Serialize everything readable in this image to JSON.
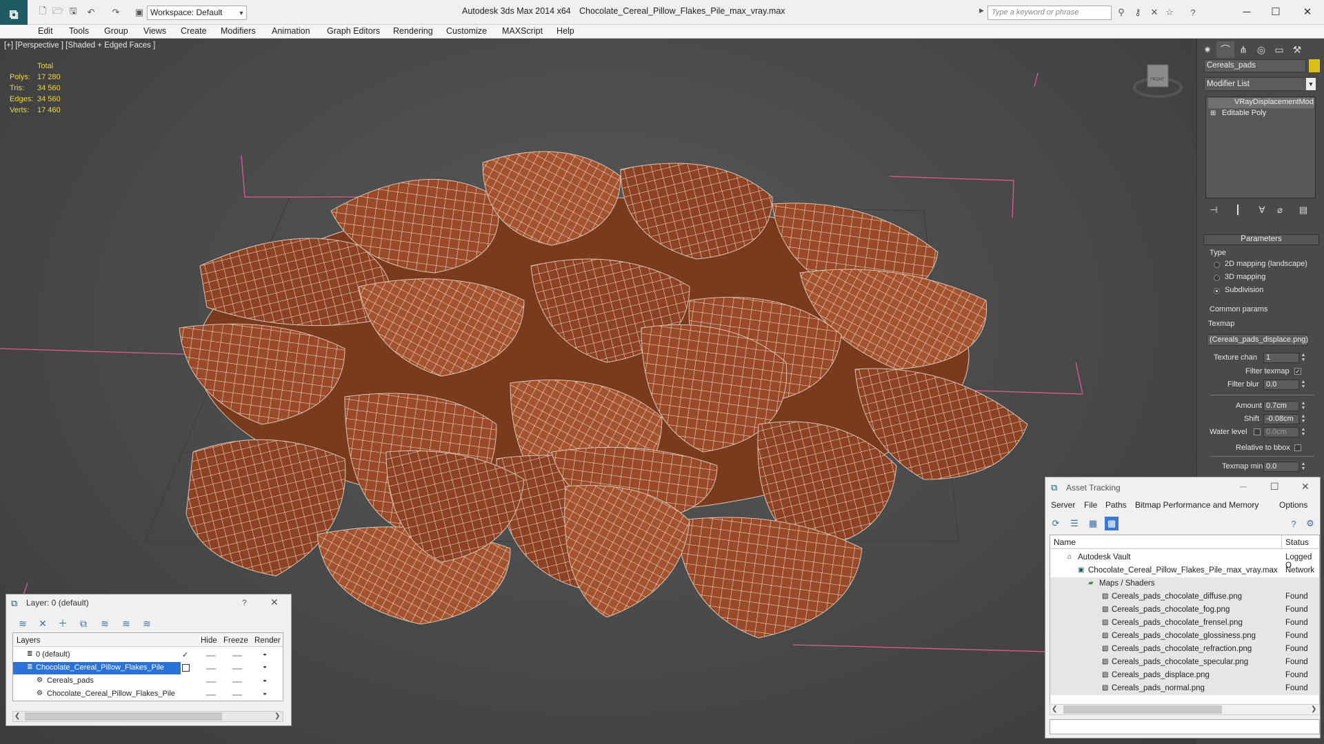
{
  "window": {
    "app_title": "Autodesk 3ds Max  2014 x64",
    "doc_title": "Chocolate_Cereal_Pillow_Flakes_Pile_max_vray.max",
    "workspace": "Workspace: Default",
    "search_placeholder": "Type a keyword or phrase"
  },
  "menu": [
    "Edit",
    "Tools",
    "Group",
    "Views",
    "Create",
    "Modifiers",
    "Animation",
    "Graph Editors",
    "Rendering",
    "Customize",
    "MAXScript",
    "Help"
  ],
  "viewport": {
    "label": "[+] [Perspective ] [Shaded + Edged Faces ]",
    "viewcube_label": "FRONT",
    "stats": {
      "header": "Total",
      "rows": [
        {
          "k": "Polys:",
          "v": "17 280"
        },
        {
          "k": "Tris:",
          "v": "34 560"
        },
        {
          "k": "Edges:",
          "v": "34 560"
        },
        {
          "k": "Verts:",
          "v": "17 460"
        }
      ]
    }
  },
  "command_panel": {
    "object_name": "Cereals_pads",
    "object_color": "#d8c020",
    "modifier_list": "Modifier List",
    "stack": [
      "VRayDisplacementMod",
      "Editable Poly"
    ],
    "parameters": {
      "title": "Parameters",
      "type_label": "Type",
      "type_options": [
        "2D mapping (landscape)",
        "3D mapping",
        "Subdivision"
      ],
      "type_selected": 2,
      "common_label": "Common params",
      "texmap_label": "Texmap",
      "texmap_value": "(Cereals_pads_displace.png)",
      "texture_chan_label": "Texture chan",
      "texture_chan_value": "1",
      "filter_texmap_label": "Filter texmap",
      "filter_blur_label": "Filter blur",
      "filter_blur_value": "0.0",
      "amount_label": "Amount",
      "amount_value": "0.7cm",
      "shift_label": "Shift",
      "shift_value": "-0.08cm",
      "water_label": "Water level",
      "water_value": "0.0cm",
      "relative_label": "Relative to bbox",
      "texmap_min_label": "Texmap min",
      "texmap_min_value": "0.0"
    }
  },
  "layer_dialog": {
    "title": "Layer: 0 (default)",
    "help": "?",
    "columns": [
      "Layers",
      "Hide",
      "Freeze",
      "Render"
    ],
    "rows": [
      {
        "name": "0 (default)",
        "indent": 0,
        "selected": false
      },
      {
        "name": "Chocolate_Cereal_Pillow_Flakes_Pile",
        "indent": 0,
        "selected": true
      },
      {
        "name": "Cereals_pads",
        "indent": 1,
        "selected": false
      },
      {
        "name": "Chocolate_Cereal_Pillow_Flakes_Pile",
        "indent": 1,
        "selected": false
      }
    ]
  },
  "asset_tracking": {
    "title": "Asset Tracking",
    "menu": [
      "Server",
      "File",
      "Paths",
      "Bitmap Performance and Memory",
      "Options"
    ],
    "columns": [
      "Name",
      "Status"
    ],
    "rows": [
      {
        "name": "Autodesk Vault",
        "status": "Logged O",
        "indent": 0
      },
      {
        "name": "Chocolate_Cereal_Pillow_Flakes_Pile_max_vray.max",
        "status": "Network",
        "indent": 1
      },
      {
        "name": "Maps / Shaders",
        "status": "",
        "indent": 2
      },
      {
        "name": "Cereals_pads_chocolate_diffuse.png",
        "status": "Found",
        "indent": 3
      },
      {
        "name": "Cereals_pads_chocolate_fog.png",
        "status": "Found",
        "indent": 3
      },
      {
        "name": "Cereals_pads_chocolate_frensel.png",
        "status": "Found",
        "indent": 3
      },
      {
        "name": "Cereals_pads_chocolate_glossiness.png",
        "status": "Found",
        "indent": 3
      },
      {
        "name": "Cereals_pads_chocolate_refraction.png",
        "status": "Found",
        "indent": 3
      },
      {
        "name": "Cereals_pads_chocolate_specular.png",
        "status": "Found",
        "indent": 3
      },
      {
        "name": "Cereals_pads_displace.png",
        "status": "Found",
        "indent": 3
      },
      {
        "name": "Cereals_pads_normal.png",
        "status": "Found",
        "indent": 3
      }
    ]
  },
  "colors": {
    "selection": "#2b72d8",
    "cereal": "#9a4a28",
    "wire": "#ffffff",
    "stats_text": "#e8d84a",
    "bbox_lines": "#e05a9a"
  }
}
